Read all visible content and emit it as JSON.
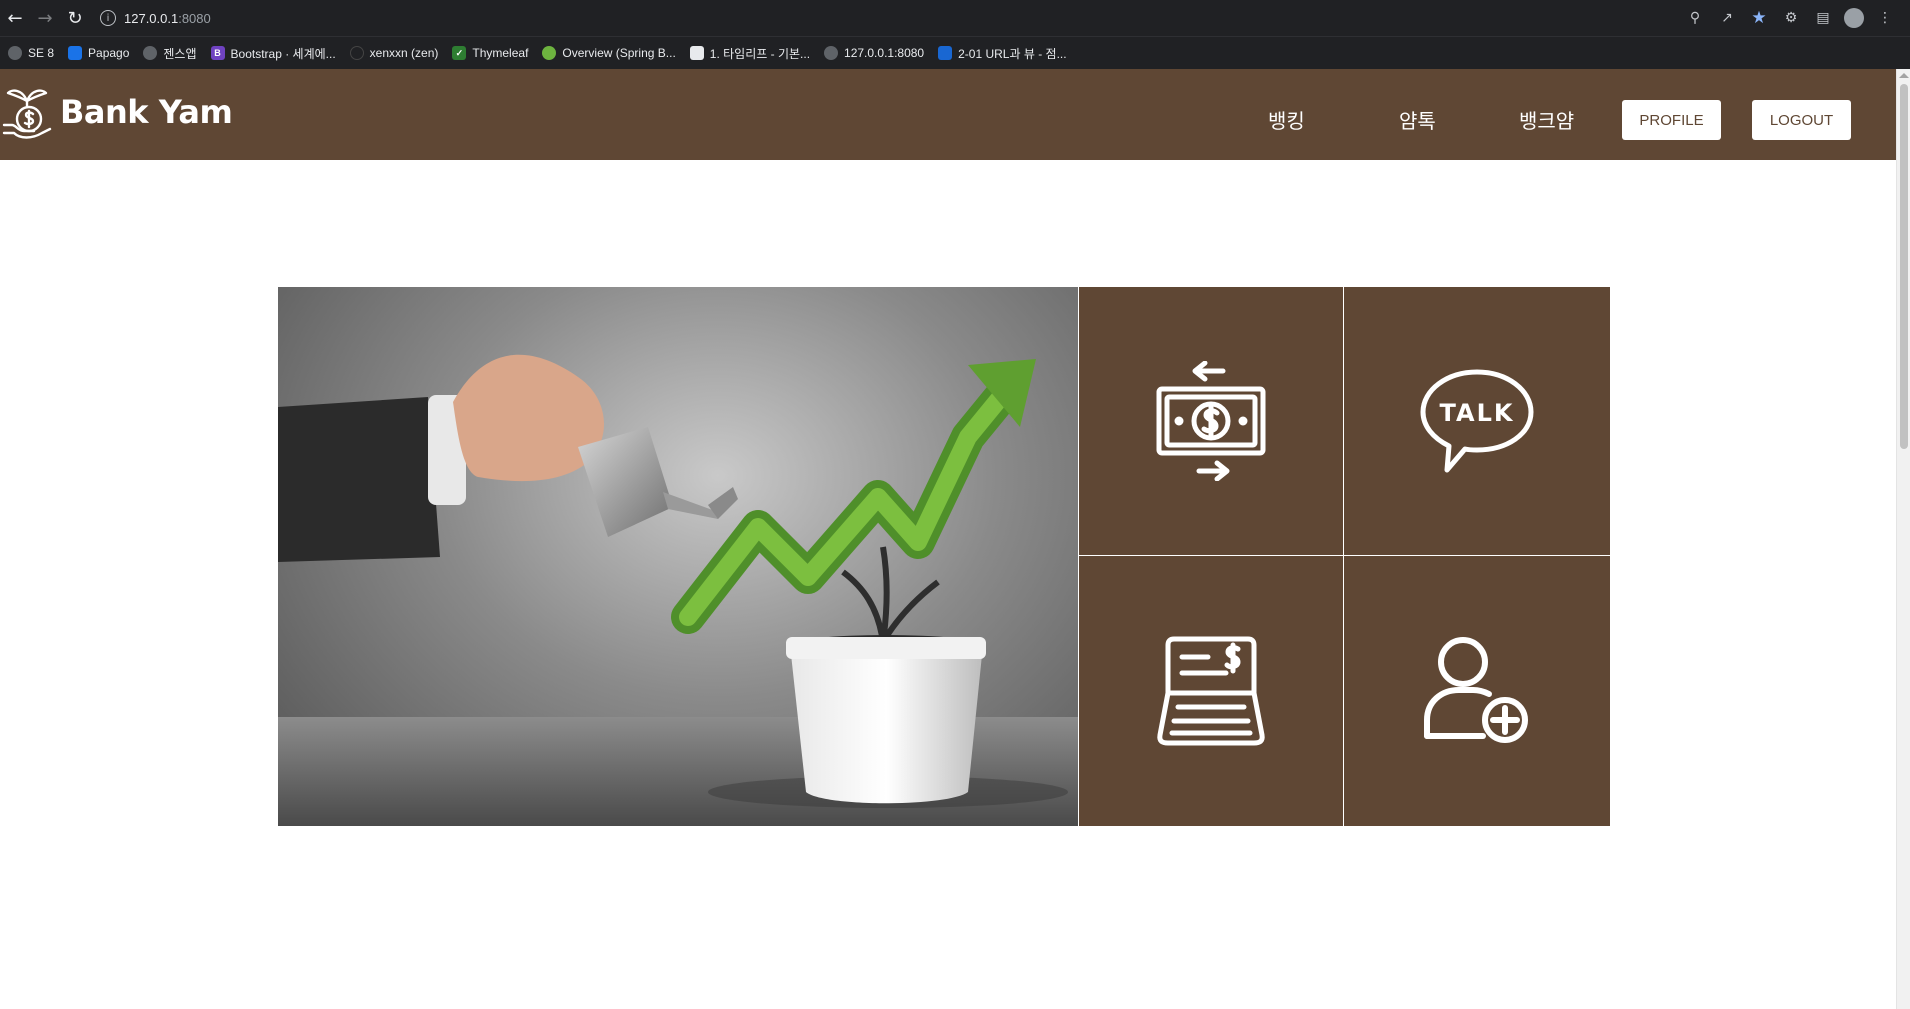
{
  "browser": {
    "url_host": "127.0.0.1",
    "url_port": ":8080",
    "bookmarks": [
      {
        "label": "SE 8",
        "color": "#5f6368"
      },
      {
        "label": "Papago",
        "color": "#1a73e8"
      },
      {
        "label": "젠스앱",
        "color": "#5f6368"
      },
      {
        "label": "Bootstrap · 세계에...",
        "color": "#6f42c1"
      },
      {
        "label": "xenxxn (zen)",
        "color": "#202124"
      },
      {
        "label": "Thymeleaf",
        "color": "#2e7d32"
      },
      {
        "label": "Overview (Spring B...",
        "color": "#6db33f"
      },
      {
        "label": "1. 타임리프 - 기본...",
        "color": "#e8eaed"
      },
      {
        "label": "127.0.0.1:8080",
        "color": "#5f6368"
      },
      {
        "label": "2-01 URL과 뷰 - 점...",
        "color": "#1967d2"
      }
    ]
  },
  "header": {
    "logo_text": "Bank Yam",
    "nav": [
      "뱅킹",
      "얌톡",
      "뱅크얌"
    ],
    "profile_label": "PROFILE",
    "logout_label": "LOGOUT",
    "brand_color": "#5f4734"
  },
  "tiles": [
    {
      "icon": "money-transfer-icon"
    },
    {
      "icon": "talk-bubble-icon"
    },
    {
      "icon": "invoice-receipt-icon"
    },
    {
      "icon": "add-user-icon"
    }
  ],
  "talk_text": "TALK"
}
